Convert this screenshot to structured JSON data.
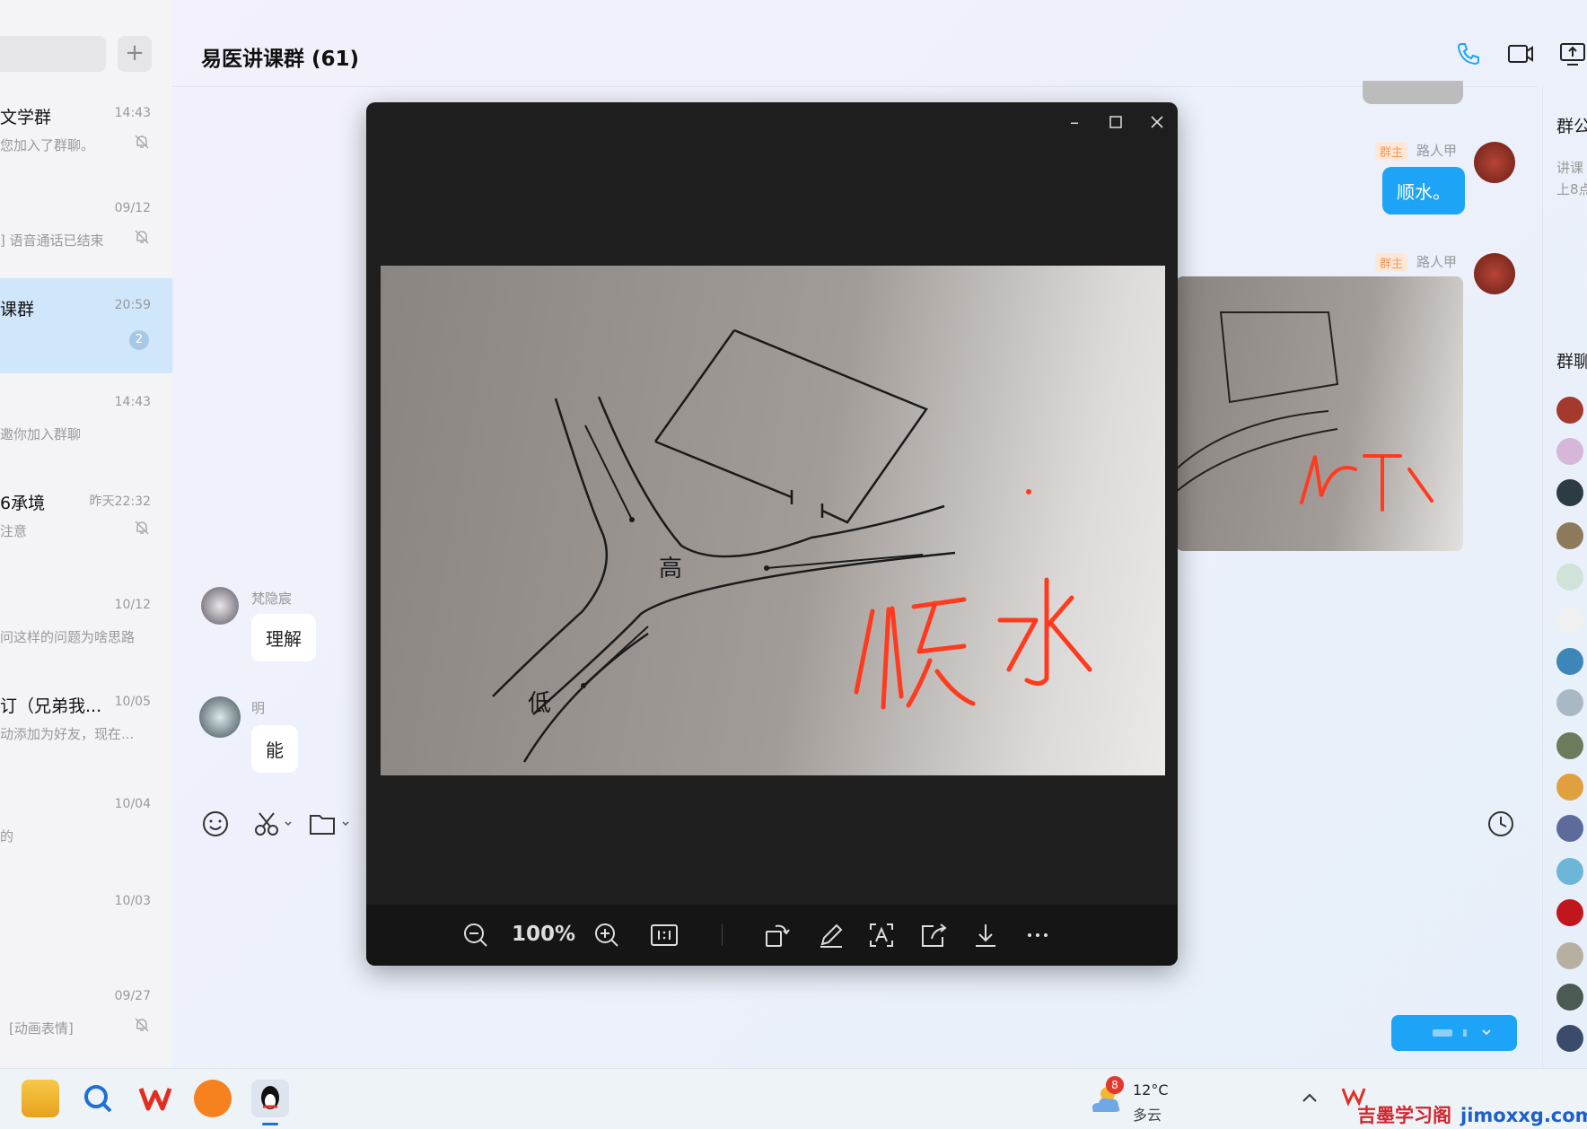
{
  "sidebar": {
    "conversations": [
      {
        "name": "文学群",
        "time": "14:43",
        "preview": "您加入了群聊。",
        "muted": true
      },
      {
        "name": "",
        "time": "09/12",
        "preview": "] 语音通话已结束",
        "muted": true
      },
      {
        "name": "课群",
        "time": "20:59",
        "preview": "",
        "badge": "2",
        "active": true
      },
      {
        "name": "",
        "time": "14:43",
        "preview": "邀你加入群聊",
        "muted": false
      },
      {
        "name": "6承境",
        "time": "昨天22:32",
        "preview": "注意",
        "muted": true
      },
      {
        "name": "",
        "time": "10/12",
        "preview": "问这样的问题为啥思路",
        "muted": false
      },
      {
        "name": "订（兄弟我...",
        "time": "10/05",
        "preview": "动添加为好友，现在...",
        "muted": false
      },
      {
        "name": "",
        "time": "10/04",
        "preview": "的",
        "muted": false
      },
      {
        "name": "",
        "time": "10/03",
        "preview": "",
        "muted": false
      },
      {
        "name": "",
        "time": "09/27",
        "preview": "[动画表情]",
        "muted": true
      }
    ]
  },
  "chat": {
    "title": "易医讲课群 (61)",
    "messages": [
      {
        "sender": "路人甲",
        "role": "群主",
        "text": "顺水。"
      },
      {
        "sender": "梵隐宸",
        "text": "理解"
      },
      {
        "sender": "明",
        "text": "能"
      }
    ]
  },
  "right_panel": {
    "notice_label": "群公",
    "notice_text_1": "讲课",
    "notice_text_2": "上8点",
    "members_label": "群聊"
  },
  "viewer": {
    "zoom": "100%",
    "photo_labels": {
      "high": "高",
      "low": "低",
      "caption": "顺水"
    }
  },
  "taskbar": {
    "weather_badge": "8",
    "temperature": "12°C",
    "weather": "多云",
    "watermark_cn": "吉墨学习阁",
    "watermark_en": "jimoxxg.com"
  },
  "colors": {
    "accent": "#1ea4f6",
    "role_tag": "#f29a5a",
    "ink_red": "#ff3b1f"
  }
}
